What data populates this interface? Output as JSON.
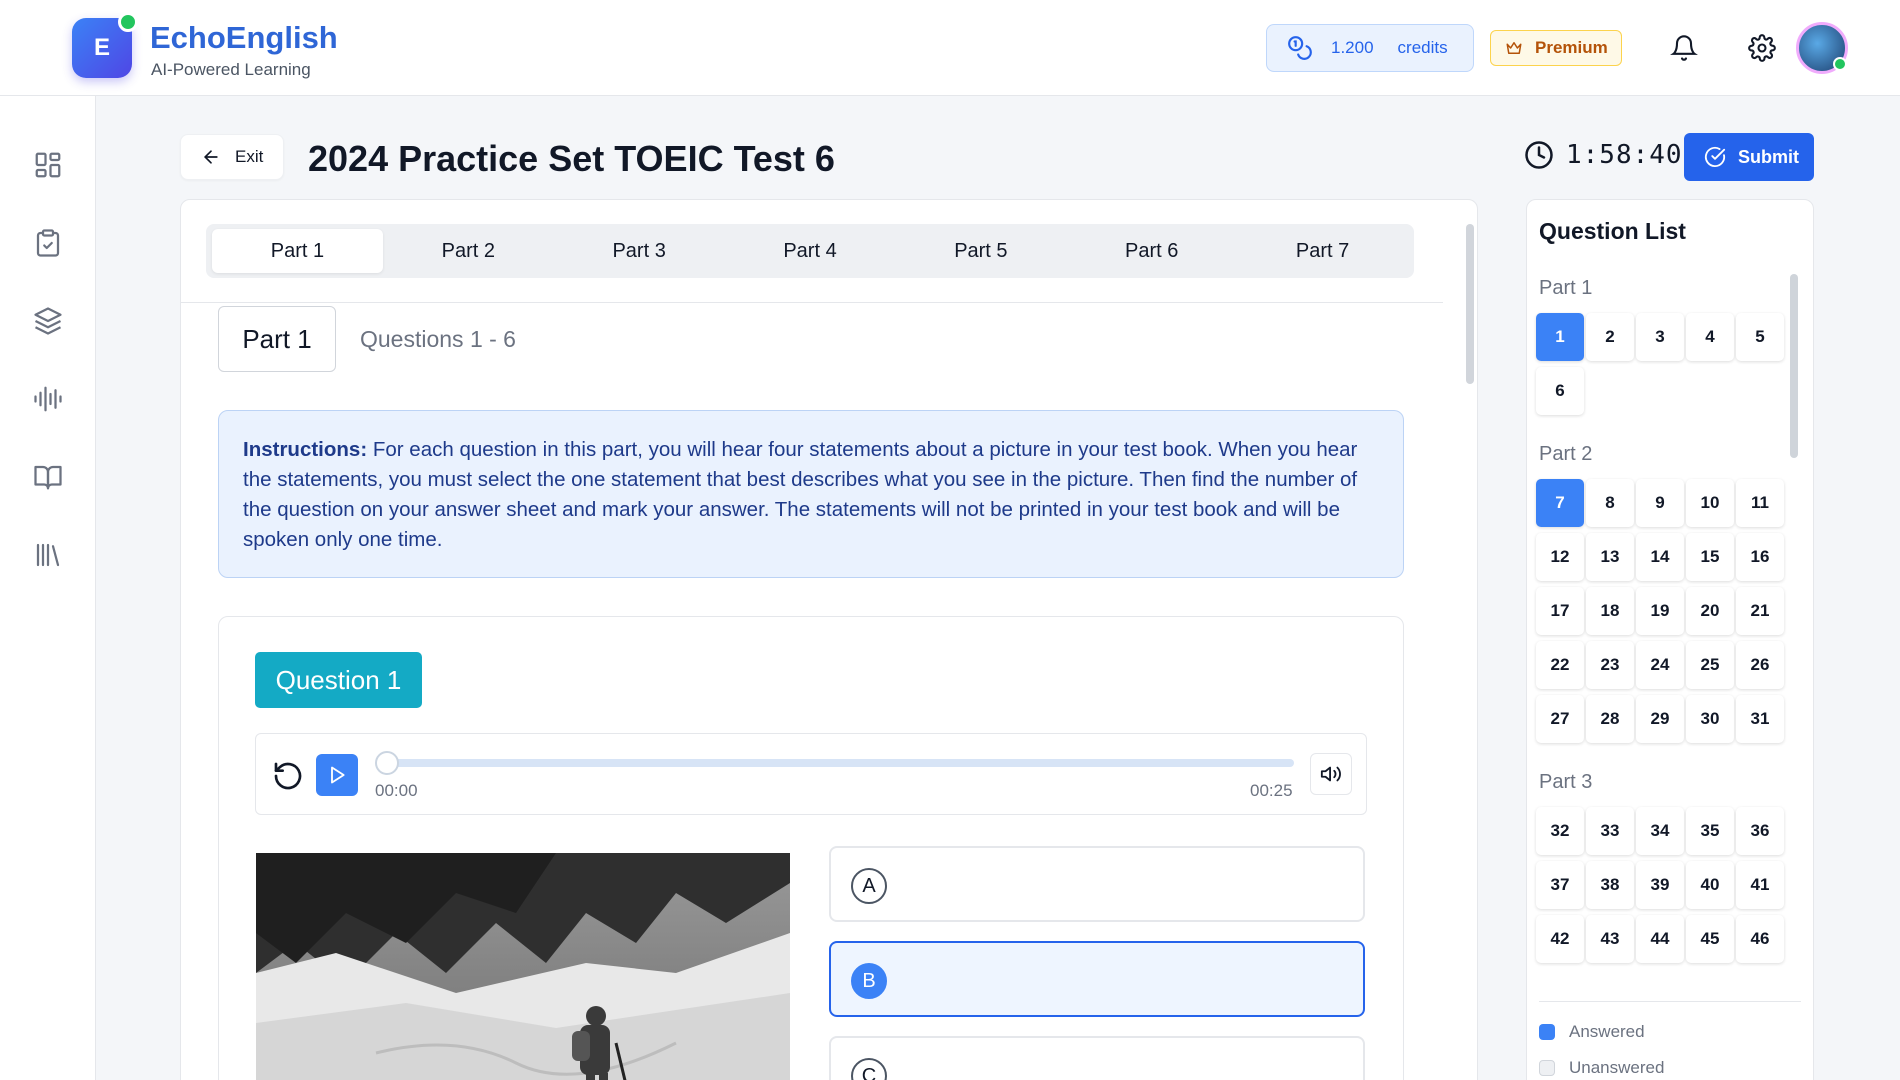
{
  "brand": {
    "logo_letter": "E",
    "name": "EchoEnglish",
    "tagline": "AI-Powered Learning"
  },
  "header": {
    "credits_value": "1.200",
    "credits_label": "credits",
    "premium_label": "Premium",
    "colors": {
      "primary": "#2563eb",
      "accent": "#14aac5",
      "premium": "#b45309"
    }
  },
  "sidebar": {
    "icons": [
      "dashboard-icon",
      "clipboard-check-icon",
      "layers-icon",
      "audio-wave-icon",
      "book-open-icon",
      "library-icon"
    ]
  },
  "toolbar": {
    "exit_label": "Exit",
    "title": "2024 Practice Set TOEIC Test 6",
    "timer": "1:58:40",
    "submit_label": "Submit"
  },
  "tabs": [
    "Part 1",
    "Part 2",
    "Part 3",
    "Part 4",
    "Part 5",
    "Part 6",
    "Part 7"
  ],
  "active_tab": "Part 1",
  "section": {
    "part_label": "Part 1",
    "range_label": "Questions 1 - 6",
    "instructions_label": "Instructions:",
    "instructions_text": " For each question in this part, you will hear four statements about a picture in your test book. When you hear the statements, you must select the one statement that best describes what you see in the picture. Then find the number of the question on your answer sheet and mark your answer. The statements will not be printed in your test book and will be spoken only one time."
  },
  "question": {
    "label": "Question 1",
    "audio": {
      "current": "00:00",
      "duration": "00:25",
      "progress": 0
    },
    "options": [
      "A",
      "B",
      "C"
    ],
    "selected": "B"
  },
  "question_list": {
    "title": "Question List",
    "parts": [
      {
        "label": "Part 1",
        "numbers": [
          "1",
          "2",
          "3",
          "4",
          "5",
          "6"
        ],
        "active": "1"
      },
      {
        "label": "Part 2",
        "numbers": [
          "7",
          "8",
          "9",
          "10",
          "11",
          "12",
          "13",
          "14",
          "15",
          "16",
          "17",
          "18",
          "19",
          "20",
          "21",
          "22",
          "23",
          "24",
          "25",
          "26",
          "27",
          "28",
          "29",
          "30",
          "31"
        ],
        "active": "7"
      },
      {
        "label": "Part 3",
        "numbers": [
          "32",
          "33",
          "34",
          "35",
          "36",
          "37",
          "38",
          "39",
          "40",
          "41",
          "42",
          "43",
          "44",
          "45",
          "46"
        ],
        "active": ""
      }
    ],
    "legend": {
      "answered": "Answered",
      "unanswered": "Unanswered"
    }
  }
}
